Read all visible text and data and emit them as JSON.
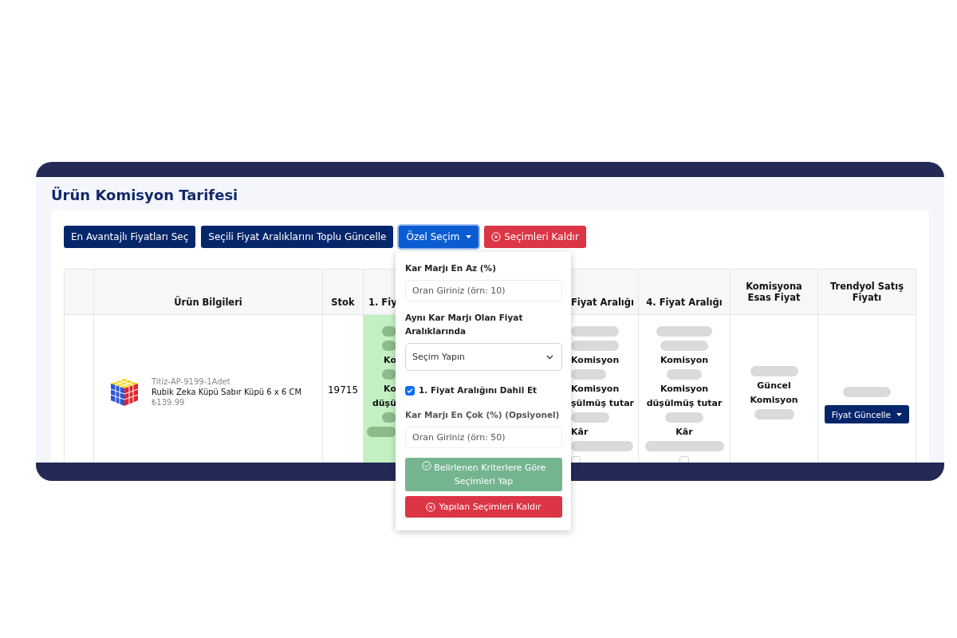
{
  "title": "Ürün Komisyon Tarifesi",
  "toolbar": [
    {
      "kind": "navy",
      "label": "En Avantajlı Fiyatları Seç"
    },
    {
      "kind": "navy",
      "label": "Seçili Fiyat Aralıklarını Toplu Güncelle"
    },
    {
      "kind": "dropdown",
      "label": "Özel Seçim",
      "expanded": true
    },
    {
      "kind": "danger",
      "label": "Seçimleri Kaldır"
    }
  ],
  "table": {
    "columns": [
      "Ürün Bilgileri",
      "Stok",
      "1. Fiy",
      "Fiyat Aralığı",
      "4. Fiyat Aralığı",
      "Komisyona Esas Fiyat",
      "Trendyol Satış Fiyatı"
    ],
    "rows": [
      {
        "sku": "Titiz-AP-9199-1Adet",
        "name": "Rubik Zeka Küpü Sabır Küpü 6 x 6 CM",
        "price": "₺139.99",
        "stock": "19715",
        "ranges": [
          {
            "selected": true,
            "commission": "Ko",
            "net": [
              "Ko",
              "düşü"
            ]
          },
          {
            "selected": false,
            "checked": false,
            "commission": "Komisyon",
            "net": [
              "Komisyon",
              "şülmüş tutar"
            ],
            "profit": "Kâr"
          },
          {
            "selected": false,
            "checked": false,
            "commission": "Komisyon",
            "net": [
              "Komisyon düşülmüş tutar"
            ],
            "profit": "Kâr"
          }
        ],
        "base_label": "Güncel Komisyon",
        "action": "Fiyat Güncelle"
      }
    ]
  },
  "dropdown": [
    {
      "kind": "label",
      "text": "Kar Marjı En Az (%)"
    },
    {
      "kind": "input",
      "placeholder": "Oran Giriniz (örn: 10)"
    },
    {
      "kind": "label",
      "text": "Aynı Kar Marjı Olan Fiyat Aralıklarında"
    },
    {
      "kind": "select",
      "value": "Seçim Yapın"
    },
    {
      "kind": "checkbox",
      "text": "1. Fiyat Aralığını Dahil Et",
      "checked": true
    },
    {
      "kind": "muted-label",
      "text": "Kar Marjı En Çok (%) (Opsiyonel)"
    },
    {
      "kind": "input",
      "placeholder": "Oran Giriniz (örn: 50)"
    },
    {
      "kind": "apply",
      "text": "Belirlenen Kriterlere Göre Seçimleri Yap"
    },
    {
      "kind": "clear",
      "text": "Yapılan Seçimleri Kaldır"
    }
  ]
}
